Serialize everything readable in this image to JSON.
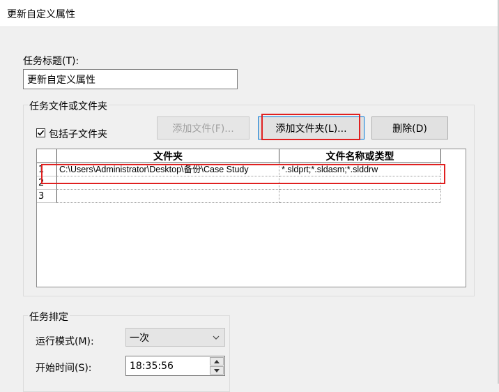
{
  "window": {
    "title": "更新自定义属性"
  },
  "task_title": {
    "label": "任务标题(T):",
    "value": "更新自定义属性"
  },
  "files_group": {
    "title": "任务文件或文件夹",
    "include_subfolders": {
      "label": "包括子文件夹",
      "checked": true
    },
    "buttons": {
      "add_file": "添加文件(F)...",
      "add_folder": "添加文件夹(L)...",
      "delete": "删除(D)"
    },
    "table": {
      "columns": [
        "文件夹",
        "文件名称或类型"
      ],
      "rows": [
        {
          "num": "1",
          "folder": "C:\\Users\\Administrator\\Desktop\\备份\\Case Study",
          "pattern": "*.sldprt;*.sldasm;*.slddrw"
        },
        {
          "num": "2",
          "folder": "",
          "pattern": ""
        },
        {
          "num": "3",
          "folder": "",
          "pattern": ""
        }
      ]
    }
  },
  "schedule_group": {
    "title": "任务排定",
    "run_mode": {
      "label": "运行模式(M):",
      "value": "一次"
    },
    "start_time": {
      "label": "开始时间(S):",
      "value": "18:35:56"
    }
  },
  "colors": {
    "highlight": "#e02020",
    "focus": "#0078d7"
  },
  "icons": [
    "checkmark-icon",
    "chevron-down-icon",
    "spin-up-icon",
    "spin-down-icon"
  ]
}
